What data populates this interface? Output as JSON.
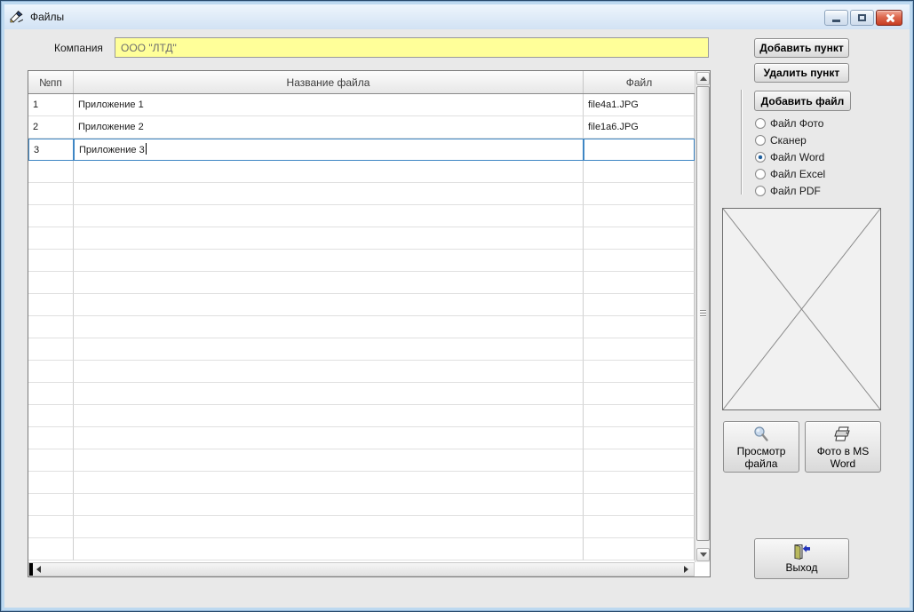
{
  "window": {
    "title": "Файлы"
  },
  "company": {
    "label": "Компания",
    "value": "ООО \"ЛТД\""
  },
  "grid": {
    "columns": {
      "num": "№пп",
      "name": "Название файла",
      "file": "Файл"
    },
    "rows": [
      {
        "num": "1",
        "name": "Приложение 1",
        "file": "file4a1.JPG"
      },
      {
        "num": "2",
        "name": "Приложение 2",
        "file": "file1a6.JPG"
      },
      {
        "num": "3",
        "name": "Приложение 3",
        "file": ""
      }
    ],
    "editing_row_index": 2,
    "empty_row_count": 18
  },
  "actions": {
    "add_item": "Добавить пункт",
    "delete_item": "Удалить пункт",
    "add_file": "Добавить файл",
    "view_file": "Просмотр файла",
    "photo_to_word": "Фото в MS Word",
    "exit": "Выход"
  },
  "file_source": {
    "options": [
      "Файл Фото",
      "Сканер",
      "Файл Word",
      "Файл Excel",
      "Файл PDF"
    ],
    "selected": "Файл Word"
  },
  "colors": {
    "edit_accent": "#3e86c4",
    "company_field_bg": "#ffff99",
    "close_button": "#c73d22"
  }
}
